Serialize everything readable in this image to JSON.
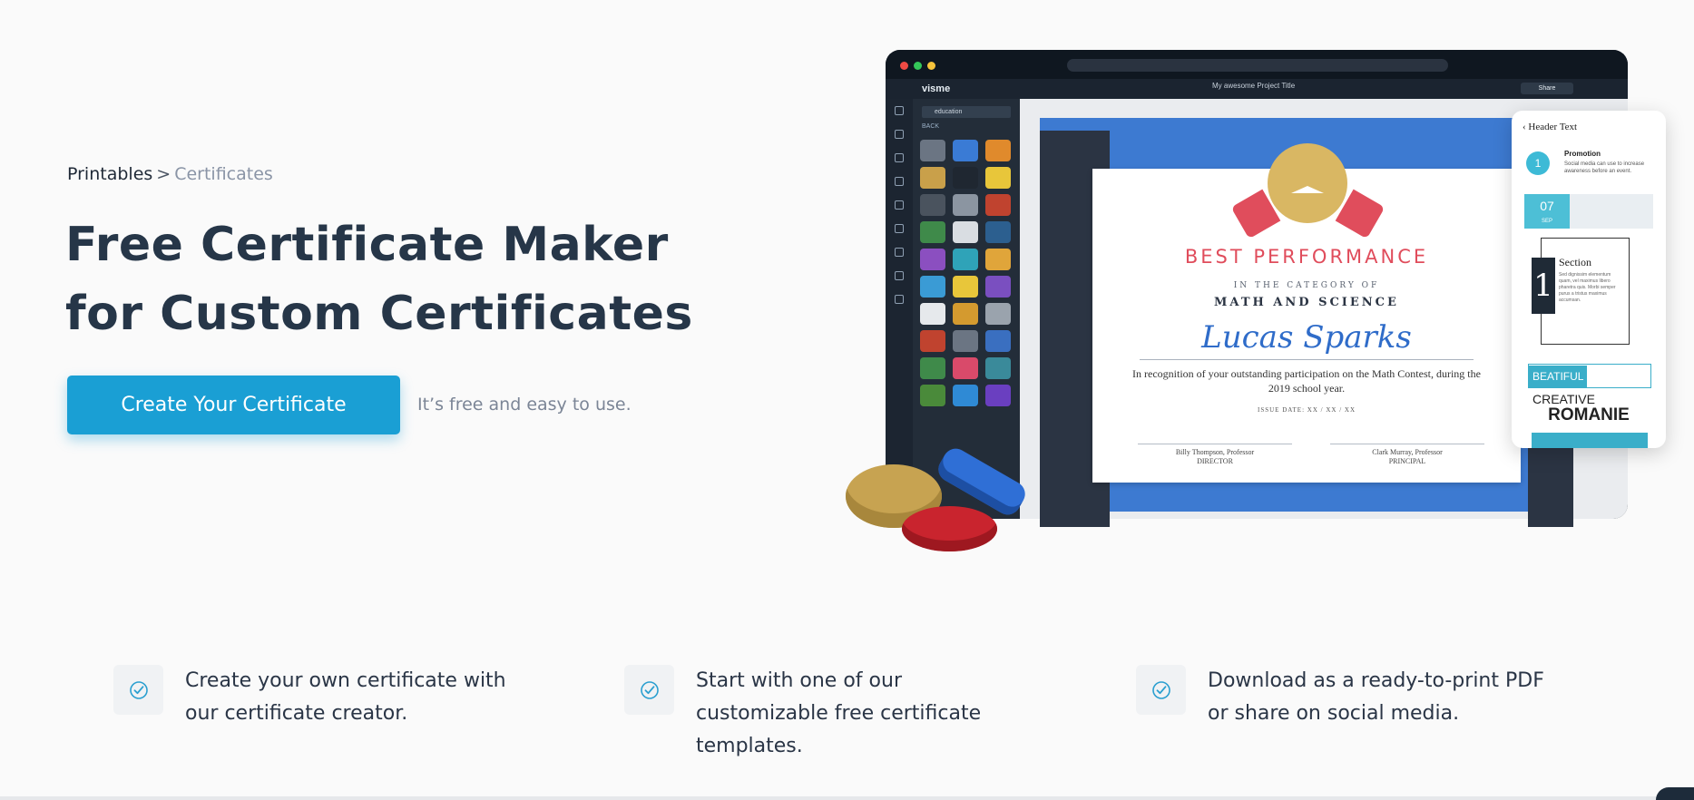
{
  "breadcrumb": {
    "root": "Printables",
    "separator": ">",
    "current": "Certificates"
  },
  "hero": {
    "title_line1": "Free Certificate Maker",
    "title_line2": "for Custom Certificates",
    "cta_label": "Create Your Certificate",
    "cta_note": "It’s free and easy to use."
  },
  "mockup": {
    "brand": "visme",
    "project_title": "My awesome Project Title",
    "share_label": "Share",
    "search_value": "education",
    "back_label": "BACK",
    "certificate": {
      "heading": "BEST PERFORMANCE",
      "subheading": "IN THE CATEGORY OF",
      "category": "MATH AND SCIENCE",
      "recipient": "Lucas Sparks",
      "body": "In recognition of your outstanding participation on the Math Contest, during the 2019 school year.",
      "issue_date": "ISSUE DATE: XX / XX / XX",
      "signer1_name": "Billy Thompson, Professor",
      "signer1_title": "DIRECTOR",
      "signer2_name": "Clark Murray, Professor",
      "signer2_title": "PRINCIPAL"
    },
    "side_card": {
      "header": "Header Text",
      "step_number": "1",
      "promo_title": "Promotion",
      "promo_text": "Social media can use to increase awareness before an event.",
      "date_day": "07",
      "date_month": "SEP",
      "section_number": "1",
      "section_title": "Section",
      "section_text": "Sed dignissim elementum quam, vel maximus libero pharetra quis. Morbi semper purus a tristus maximus accumsan.",
      "beautiful": "BEATIFUL",
      "creative": "CREATIVE",
      "romanie": "ROMANIE"
    }
  },
  "features": [
    {
      "text": "Create your own certificate with our certificate creator."
    },
    {
      "text": "Start with one of our customizable free certificate templates."
    },
    {
      "text": "Download as a ready-to-print PDF or share on social media."
    }
  ],
  "colors": {
    "accent": "#1a9fd4",
    "title": "#263648",
    "cert_red": "#e04d5c",
    "cert_blue": "#3d7ad1"
  }
}
